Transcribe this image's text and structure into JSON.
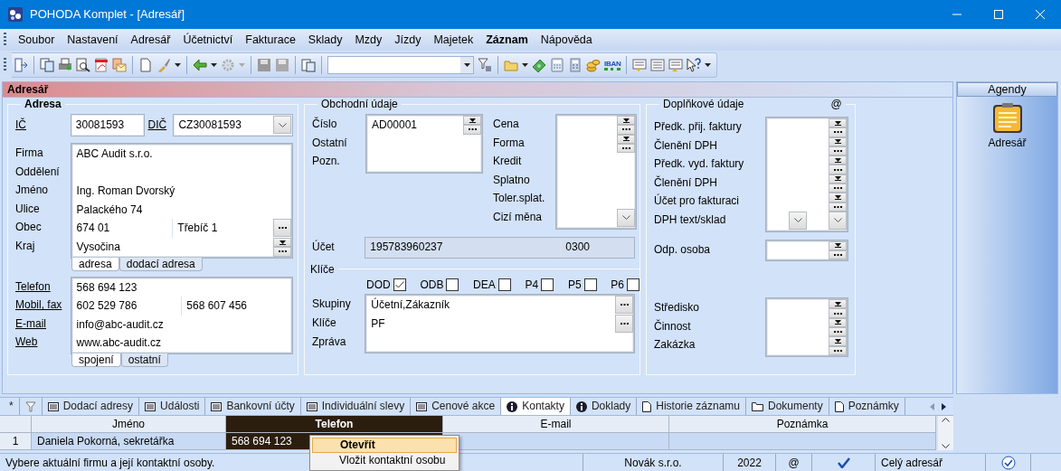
{
  "window": {
    "title": "POHODA Komplet - [Adresář]"
  },
  "menu": [
    {
      "label": "Soubor",
      "bold": false
    },
    {
      "label": "Nastavení",
      "bold": false
    },
    {
      "label": "Adresář",
      "bold": false
    },
    {
      "label": "Účetnictví",
      "bold": false
    },
    {
      "label": "Fakturace",
      "bold": false
    },
    {
      "label": "Sklady",
      "bold": false
    },
    {
      "label": "Mzdy",
      "bold": false
    },
    {
      "label": "Jízdy",
      "bold": false
    },
    {
      "label": "Majetek",
      "bold": false
    },
    {
      "label": "Záznam",
      "bold": true
    },
    {
      "label": "Nápověda",
      "bold": false
    }
  ],
  "toolbar": {
    "iban_label": "IBAN"
  },
  "panel": {
    "title": "Adresář"
  },
  "address": {
    "title": "Adresa",
    "bold": true,
    "ic": {
      "label": "IČ",
      "link": true,
      "value": "30081593"
    },
    "dic": {
      "label": "DIČ",
      "link": true,
      "value": "CZ30081593"
    },
    "address_block": {
      "rows": [
        {
          "label": "Firma",
          "link": false,
          "values": [
            "ABC Audit s.r.o."
          ]
        },
        {
          "label": "Oddělení",
          "link": false
        },
        {
          "label": "Jméno",
          "link": false,
          "values": [
            "Ing. Roman Dvorský"
          ]
        },
        {
          "label": "Ulice",
          "link": false,
          "values": [
            "Palackého 74"
          ]
        },
        {
          "label": "Obec",
          "link": false,
          "values": [
            "674 01",
            "Třebíč 1"
          ],
          "more": true
        },
        {
          "label": "Kraj",
          "link": false,
          "values": [
            "Vysočina"
          ],
          "picker": true,
          "more": true
        }
      ],
      "tabs": [
        {
          "label": "adresa",
          "selected": true
        },
        {
          "label": "dodací adresa",
          "selected": false
        }
      ]
    },
    "contact_block": {
      "rows": [
        {
          "label": "Telefon",
          "link": true,
          "values": [
            "568 694 123"
          ]
        },
        {
          "label": "Mobil, fax",
          "link": true,
          "values": [
            "602 529 786",
            "568 607 456"
          ]
        },
        {
          "label": "E-mail",
          "link": true,
          "values": [
            "info@abc-audit.cz"
          ]
        },
        {
          "label": "Web",
          "link": true,
          "values": [
            "www.abc-audit.cz"
          ]
        }
      ],
      "tabs": [
        {
          "label": "spojení",
          "selected": true
        },
        {
          "label": "ostatní",
          "selected": false
        }
      ]
    }
  },
  "commerce": {
    "title": "Obchodní údaje",
    "bold": false,
    "left_block": {
      "rows": [
        {
          "label": "Číslo",
          "values": [
            "AD00001"
          ],
          "picker": true,
          "more": true
        },
        {
          "label": "Ostatní"
        },
        {
          "label": "Pozn."
        }
      ]
    },
    "right_block": {
      "rows": [
        {
          "label": "Cena",
          "picker": true,
          "more": true
        },
        {
          "label": "Forma",
          "picker": true,
          "more": true
        },
        {
          "label": "Kredit"
        },
        {
          "label": "Splatno"
        },
        {
          "label": "Toler.splat."
        },
        {
          "label": "Cizí měna",
          "chevron": true
        }
      ]
    },
    "account": {
      "label": "Účet",
      "values": [
        "195783960237",
        "0300"
      ]
    },
    "keys_title": "Klíče",
    "checkboxes": [
      {
        "label": "DOD",
        "checked": true
      },
      {
        "label": "ODB",
        "checked": false
      },
      {
        "label": "DEA",
        "checked": false
      },
      {
        "label": "P4",
        "checked": false
      },
      {
        "label": "P5",
        "checked": false
      },
      {
        "label": "P6",
        "checked": false
      }
    ],
    "keys_block": {
      "rows": [
        {
          "label": "Skupiny",
          "values": [
            "Účetní,Zákazník"
          ],
          "more": true
        },
        {
          "label": "Klíče",
          "values": [
            "PF"
          ],
          "more": true
        },
        {
          "label": "Zpráva"
        }
      ]
    }
  },
  "extra": {
    "title": "Doplňkové údaje",
    "at": "@",
    "bold": false,
    "block1": {
      "rows": [
        {
          "label": "Předk. přij. faktury",
          "picker": true,
          "more": true
        },
        {
          "label": "Členění DPH",
          "picker": true,
          "more": true
        },
        {
          "label": "Předk. vyd. faktury",
          "picker": true,
          "more": true
        },
        {
          "label": "Členění DPH",
          "picker": true,
          "more": true
        },
        {
          "label": "Účet pro fakturaci",
          "picker": true,
          "more": true
        },
        {
          "label": "DPH text/sklad",
          "inner_chevron": true,
          "chevron": true
        }
      ]
    },
    "block2": {
      "rows": [
        {
          "label": "Odp. osoba",
          "picker": true,
          "more": true
        }
      ]
    },
    "block3": {
      "rows": [
        {
          "label": "Středisko",
          "picker": true,
          "more": true
        },
        {
          "label": "Činnost",
          "picker": true,
          "more": true
        },
        {
          "label": "Zakázka",
          "picker": true,
          "more": true
        }
      ]
    }
  },
  "agendas": {
    "header": "Agendy",
    "items": [
      {
        "label": "Adresář"
      }
    ]
  },
  "bottom_tabs": [
    {
      "kind": "text",
      "label": "*",
      "selected": false
    },
    {
      "kind": "filter",
      "selected": false
    },
    {
      "kind": "list",
      "label": "Dodací adresy",
      "selected": false
    },
    {
      "kind": "list",
      "label": "Události",
      "selected": false
    },
    {
      "kind": "list",
      "label": "Bankovní účty",
      "selected": false
    },
    {
      "kind": "list",
      "label": "Individuální slevy",
      "selected": false
    },
    {
      "kind": "list",
      "label": "Cenové akce",
      "selected": false
    },
    {
      "kind": "info",
      "label": "Kontakty",
      "selected": true
    },
    {
      "kind": "info",
      "label": "Doklady",
      "selected": false
    },
    {
      "kind": "document",
      "label": "Historie záznamu",
      "selected": false
    },
    {
      "kind": "folder",
      "label": "Dokumenty",
      "selected": false
    },
    {
      "kind": "document",
      "label": "Poznámky",
      "selected": false
    }
  ],
  "table": {
    "columns": [
      {
        "label": "Jméno",
        "selected": false
      },
      {
        "label": "Telefon",
        "selected": true
      },
      {
        "label": "E-mail",
        "selected": false
      },
      {
        "label": "Poznámka",
        "selected": false
      }
    ],
    "rows": [
      {
        "number": "1",
        "selected": true,
        "cells": [
          "Daniela Pokorná, sekretářka",
          "568 694 123"
        ]
      }
    ]
  },
  "context_menu": {
    "items": [
      {
        "label": "Otevřít",
        "selected": true
      },
      {
        "label": "Vložit kontaktní osobu",
        "selected": false
      }
    ]
  },
  "status_bar": {
    "message": "Vybere aktuální firmu a její kontaktní osoby.",
    "company": "Novák s.r.o.",
    "year": "2022",
    "mail": "@",
    "scope": "Celý adresář"
  }
}
